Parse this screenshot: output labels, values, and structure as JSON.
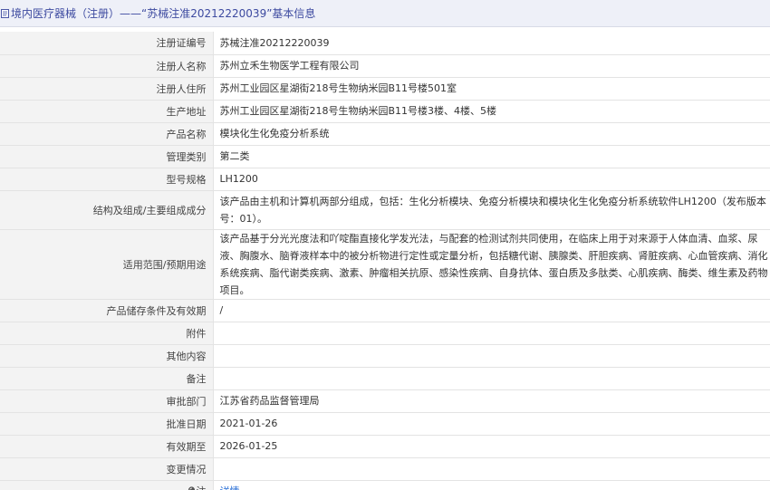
{
  "header": {
    "title": "境内医疗器械（注册）——“苏械注准20212220039”基本信息"
  },
  "rows": [
    {
      "label": "注册证编号",
      "value": "苏械注准20212220039"
    },
    {
      "label": "注册人名称",
      "value": "苏州立禾生物医学工程有限公司"
    },
    {
      "label": "注册人住所",
      "value": "苏州工业园区星湖街218号生物纳米园B11号楼501室"
    },
    {
      "label": "生产地址",
      "value": "苏州工业园区星湖街218号生物纳米园B11号楼3楼、4楼、5楼"
    },
    {
      "label": "产品名称",
      "value": "模块化生化免疫分析系统"
    },
    {
      "label": "管理类别",
      "value": "第二类"
    },
    {
      "label": "型号规格",
      "value": "LH1200"
    },
    {
      "label": "结构及组成/主要组成成分",
      "value": "该产品由主机和计算机两部分组成，包括：生化分析模块、免疫分析模块和模块化生化免疫分析系统软件LH1200（发布版本号：01）。"
    },
    {
      "label": "适用范围/预期用途",
      "value": "该产品基于分光光度法和吖啶酯直接化学发光法，与配套的检测试剂共同使用，在临床上用于对来源于人体血清、血浆、尿液、胸腹水、脑脊液样本中的被分析物进行定性或定量分析，包括糖代谢、胰腺类、肝胆疾病、肾脏疾病、心血管疾病、消化系统疾病、脂代谢类疾病、激素、肿瘤相关抗原、感染性疾病、自身抗体、蛋白质及多肽类、心肌疾病、酶类、维生素及药物项目。"
    },
    {
      "label": "产品储存条件及有效期",
      "value": "/"
    },
    {
      "label": "附件",
      "value": ""
    },
    {
      "label": "其他内容",
      "value": ""
    },
    {
      "label": "备注",
      "value": ""
    },
    {
      "label": "审批部门",
      "value": "江苏省药品监督管理局"
    },
    {
      "label": "批准日期",
      "value": "2021-01-26"
    },
    {
      "label": "有效期至",
      "value": "2026-01-25"
    },
    {
      "label": "变更情况",
      "value": ""
    }
  ],
  "note": {
    "label": "注",
    "link_text": "详情"
  },
  "icons": {
    "title": "document-icon",
    "note": "lightbulb-icon"
  }
}
